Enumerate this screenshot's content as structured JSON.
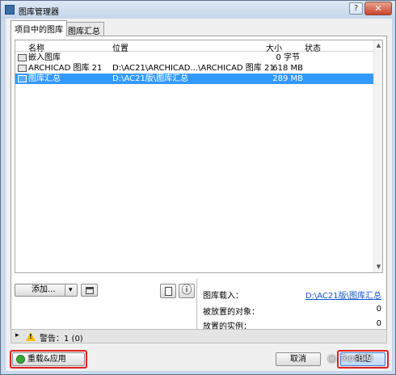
{
  "window": {
    "title": "图库管理器",
    "help_label": "?",
    "close_label": "✕"
  },
  "tabs": [
    {
      "label": "项目中的图库"
    },
    {
      "label": "图库汇总"
    }
  ],
  "list": {
    "columns": {
      "name": "名称",
      "location": "位置",
      "size": "大小",
      "status": "状态"
    },
    "rows": [
      {
        "name": "嵌入图库",
        "location": "",
        "size": "0 字节",
        "status": ""
      },
      {
        "name": "ARCHICAD 图库 21",
        "location": "D:\\AC21\\ARCHICAD...\\ARCHICAD 图库 21",
        "size": "618 MB",
        "status": ""
      },
      {
        "name": "图库汇总",
        "location": "D:\\AC21版\\图库汇总",
        "size": "289 MB",
        "status": ""
      }
    ]
  },
  "buttons": {
    "add_label": "添加...",
    "add_arrow": "▾",
    "info_label": "ⓘ"
  },
  "info": {
    "library_load_label": "图库载入：",
    "library_load_value": "D:\\AC21版\\图库汇总",
    "placed_objects_label": "被放置的对象：",
    "placed_objects_value": "0",
    "placed_instances_label": "放置的实例：",
    "placed_instances_value": "0"
  },
  "warnings": {
    "expand_icon": "▸",
    "label": "警告：1 (0)"
  },
  "footer": {
    "reload_label": "重载&应用",
    "cancel_label": "取消",
    "ok_label": "确定"
  },
  "watermark": {
    "text": "TopsBIM"
  },
  "colors": {
    "selection": "#3399ff",
    "highlight": "#e02020"
  }
}
